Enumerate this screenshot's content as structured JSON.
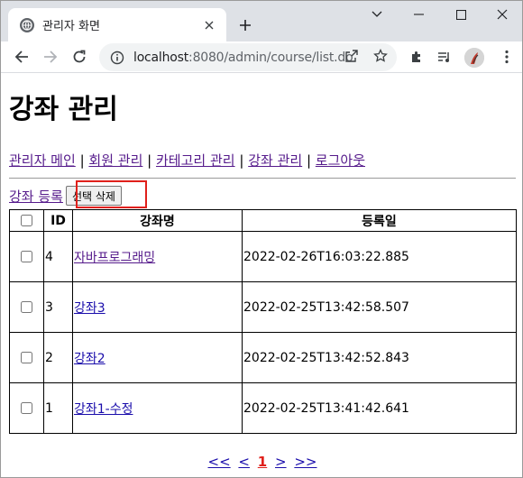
{
  "browser": {
    "tab_title": "관리자 화면",
    "url_host": "localhost",
    "url_rest": ":8080/admin/course/list.do",
    "icons": {
      "favicon": "globe-icon",
      "tab_close": "close-icon",
      "new_tab": "plus-icon",
      "tab_search": "chevron-down-icon",
      "minimize": "minimize-icon",
      "maximize": "maximize-icon",
      "close_window": "close-icon",
      "back": "arrow-left-icon",
      "forward": "arrow-right-icon",
      "reload": "reload-icon",
      "site_info": "info-icon",
      "share": "share-icon",
      "bookmark": "star-icon",
      "extensions": "puzzle-icon",
      "media": "media-list-icon",
      "menu": "kebab-menu-icon"
    }
  },
  "page": {
    "title": "강좌 관리",
    "nav": [
      {
        "label": "관리자 메인",
        "visited": true
      },
      {
        "label": "회원 관리",
        "visited": true
      },
      {
        "label": "카테고리 관리",
        "visited": true
      },
      {
        "label": "강좌 관리",
        "visited": true
      },
      {
        "label": "로그아웃",
        "visited": true
      }
    ],
    "nav_separator": "|",
    "register_link": "강좌 등록",
    "delete_button": "선택 삭제",
    "table": {
      "headers": {
        "id": "ID",
        "name": "강좌명",
        "date": "등록일"
      },
      "rows": [
        {
          "id": "4",
          "name": "자바프로그래밍",
          "date": "2022-02-26T16:03:22.885",
          "visited": true
        },
        {
          "id": "3",
          "name": "강좌3",
          "date": "2022-02-25T13:42:58.507",
          "visited": false
        },
        {
          "id": "2",
          "name": "강좌2",
          "date": "2022-02-25T13:42:52.843",
          "visited": false
        },
        {
          "id": "1",
          "name": "강좌1-수정",
          "date": "2022-02-25T13:41:42.641",
          "visited": false
        }
      ]
    },
    "pager": {
      "first": "<<",
      "prev": "<",
      "current": "1",
      "next": ">",
      "last": ">>"
    }
  },
  "colors": {
    "link": "#1a0dab",
    "visited_link": "#551a8b",
    "highlight": "#e0201b",
    "chrome_bg": "#dee1e6"
  }
}
